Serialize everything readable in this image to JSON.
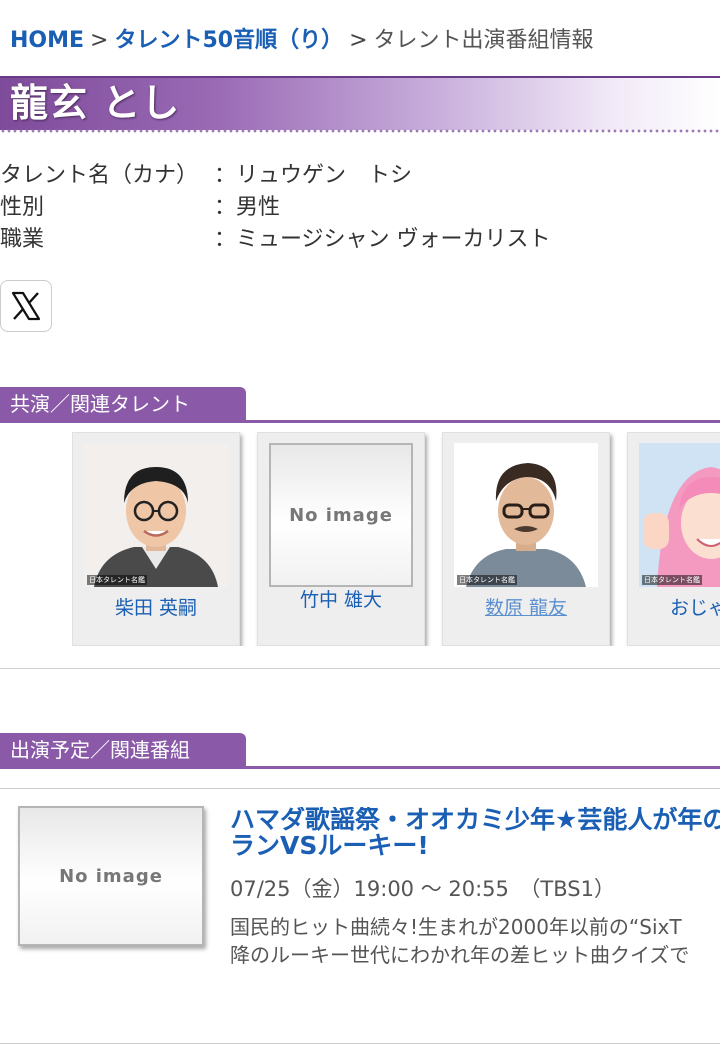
{
  "breadcrumb": {
    "home": "HOME",
    "sep1": ">",
    "level2": "タレント50音順（り）",
    "sep2": ">",
    "current": "タレント出演番組情報"
  },
  "talent": {
    "name": "龍玄 とし"
  },
  "profile": [
    {
      "key": "タレント名（カナ）",
      "value": "：リュウゲン　トシ"
    },
    {
      "key": "性別",
      "value": "：男性"
    },
    {
      "key": "職業",
      "value": "：ミュージシャン ヴォーカリスト"
    }
  ],
  "social": {
    "icon": "x-logo-icon"
  },
  "sections": {
    "costars": "共演／関連タレント",
    "programs": "出演予定／関連番組"
  },
  "costars": [
    {
      "name": "柴田 英嗣",
      "has_image": true,
      "watermark": "日本タレント名鑑"
    },
    {
      "name": "竹中 雄大",
      "has_image": false,
      "placeholder": "No image"
    },
    {
      "name": "数原 龍友",
      "has_image": true,
      "watermark": "日本タレント名鑑"
    },
    {
      "name": "おじゃ",
      "has_image": true,
      "watermark": "日本タレント名鑑"
    }
  ],
  "program": {
    "thumb_placeholder": "No image",
    "title_line1": "ハマダ歌謡祭・オオカミ少年★芸能人が年の",
    "title_line2": "ランVSルーキー!",
    "time": "07/25（金）19:00 〜 20:55　（TBS1）",
    "desc_line1": "国民的ヒット曲続々!生まれが2000年以前の“SixT",
    "desc_line2": "降のルーキー世代にわかれ年の差ヒット曲クイズで"
  },
  "colors": {
    "accent_purple": "#8a5aa8",
    "link_blue": "#1a5fb4"
  }
}
